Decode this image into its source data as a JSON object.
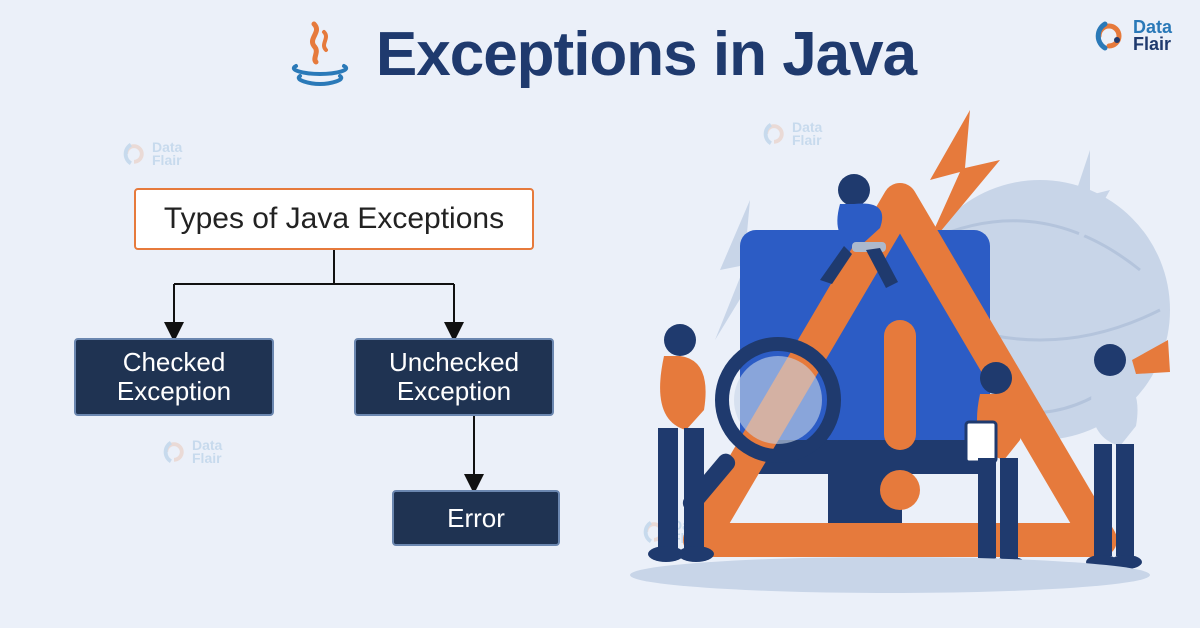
{
  "title": "Exceptions in Java",
  "logo": {
    "data": "Data",
    "flair": "Flair"
  },
  "diagram": {
    "root": "Types of Java Exceptions",
    "checked": "Checked\nException",
    "unchecked": "Unchecked\nException",
    "error": "Error"
  },
  "colors": {
    "bg": "#ebf0f9",
    "title": "#1f3a6e",
    "accent_orange": "#e67a3c",
    "box_navy": "#1f3352",
    "box_border": "#6b87b0",
    "logo_blue": "#2a79b8"
  },
  "watermark": {
    "data": "Data",
    "flair": "Flair"
  }
}
